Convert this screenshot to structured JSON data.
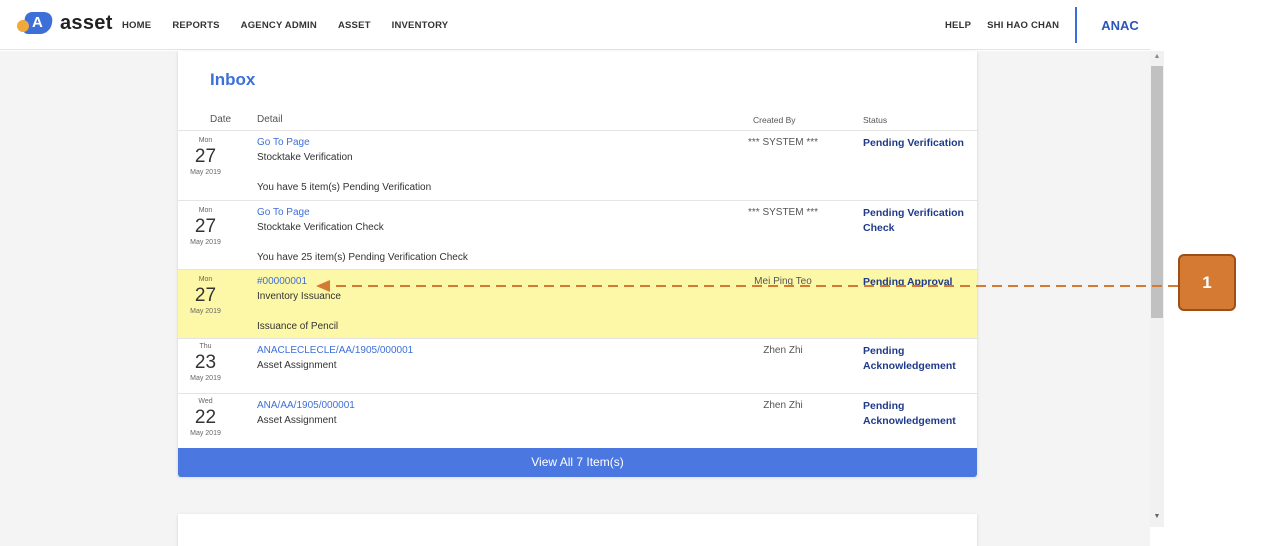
{
  "nav": {
    "logo_letter": "A",
    "logo_text": "asset",
    "left_items": [
      "HOME",
      "REPORTS",
      "AGENCY ADMIN",
      "ASSET",
      "INVENTORY"
    ],
    "help": "HELP",
    "user": "SHI HAO CHAN",
    "agency": "ANAC"
  },
  "inbox": {
    "title": "Inbox",
    "headers": {
      "date": "Date",
      "detail": "Detail",
      "created_by": "Created By",
      "status": "Status"
    },
    "rows": [
      {
        "day": "Mon",
        "num": "27",
        "month_year": "May 2019",
        "link": "Go To Page",
        "subject": "Stocktake Verification",
        "message": "You have 5 item(s) Pending Verification",
        "created_by": "*** SYSTEM ***",
        "status": "Pending Verification"
      },
      {
        "day": "Mon",
        "num": "27",
        "month_year": "May 2019",
        "link": "Go To Page",
        "subject": "Stocktake Verification Check",
        "message": "You have 25 item(s) Pending Verification Check",
        "created_by": "*** SYSTEM ***",
        "status": "Pending Verification Check"
      },
      {
        "day": "Mon",
        "num": "27",
        "month_year": "May 2019",
        "link": "#00000001",
        "subject": "Inventory Issuance",
        "message": "Issuance of Pencil",
        "created_by": "Mei Ping Teo",
        "status": "Pending Approval",
        "highlighted": true
      },
      {
        "day": "Thu",
        "num": "23",
        "month_year": "May 2019",
        "link": "ANACLECLECLE/AA/1905/000001",
        "subject": "Asset Assignment",
        "message": "",
        "created_by": "Zhen Zhi",
        "status": "Pending Acknowledgement"
      },
      {
        "day": "Wed",
        "num": "22",
        "month_year": "May 2019",
        "link": "ANA/AA/1905/000001",
        "subject": "Asset Assignment",
        "message": "",
        "created_by": "Zhen Zhi",
        "status": "Pending Acknowledgement"
      }
    ],
    "view_all": "View All 7 Item(s)"
  },
  "annotation": {
    "label": "1"
  },
  "colors": {
    "accent": "#3d6fd9",
    "status": "#1f3a8a",
    "highlight": "#fdf8a7",
    "callout": "#d57a33"
  }
}
